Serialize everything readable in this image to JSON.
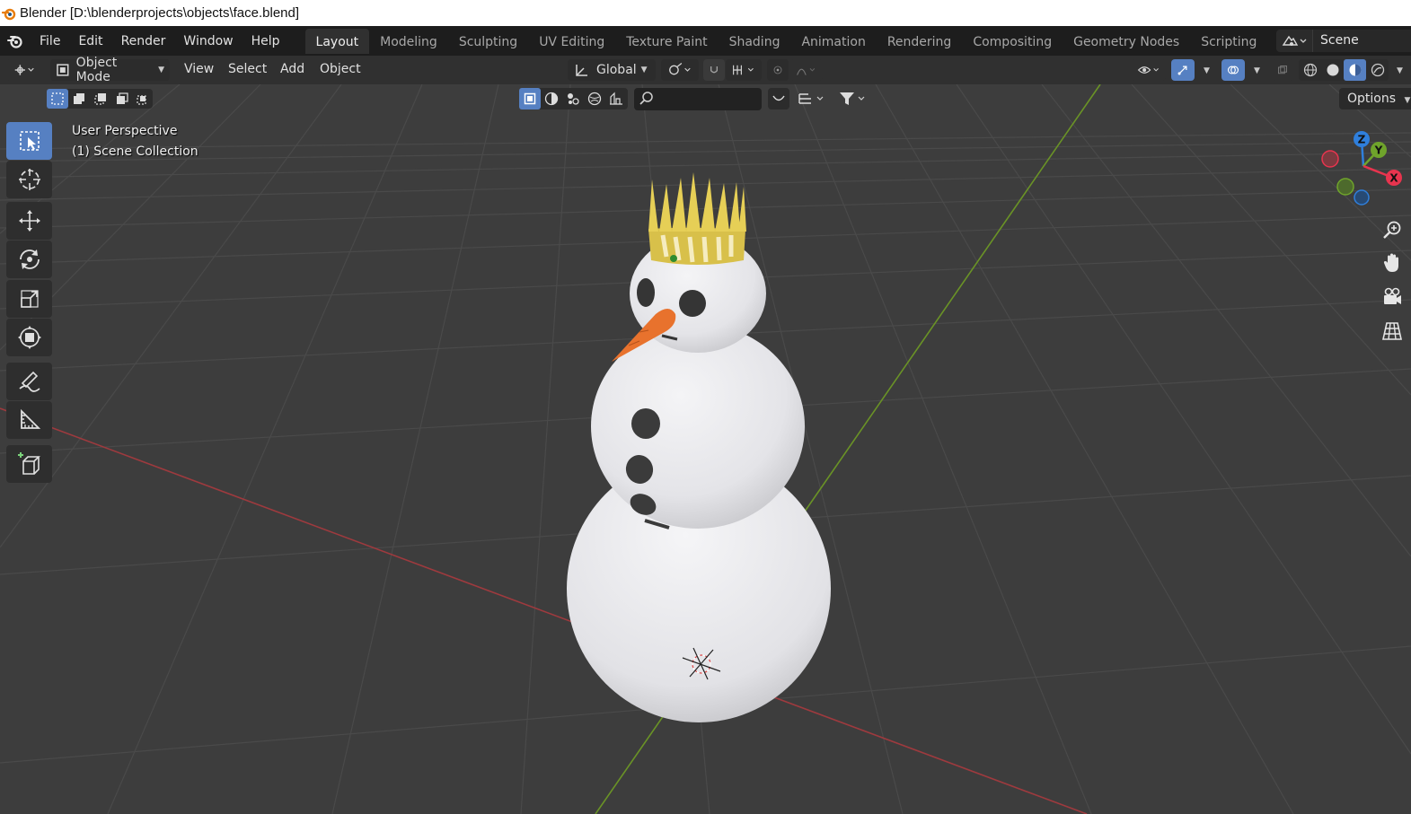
{
  "window": {
    "title": "Blender [D:\\blenderprojects\\objects\\face.blend]"
  },
  "menus": [
    "File",
    "Edit",
    "Render",
    "Window",
    "Help"
  ],
  "workspaces": {
    "tabs": [
      "Layout",
      "Modeling",
      "Sculpting",
      "UV Editing",
      "Texture Paint",
      "Shading",
      "Animation",
      "Rendering",
      "Compositing",
      "Geometry Nodes",
      "Scripting"
    ],
    "active": "Layout",
    "add_symbol": "+"
  },
  "scene": {
    "name": "Scene"
  },
  "viewport_header": {
    "mode": "Object Mode",
    "menus": [
      "View",
      "Select",
      "Add",
      "Object"
    ],
    "transform_orientation": "Global"
  },
  "viewport": {
    "perspective_label": "User Perspective",
    "collection_label": "(1) Scene Collection",
    "options_label": "Options"
  },
  "gizmo": {
    "axes": [
      "Z",
      "Y",
      "X"
    ],
    "colors": {
      "x": "#e8344e",
      "y": "#6fa42b",
      "z": "#2f7fdc"
    }
  },
  "icons": {
    "toolbar": [
      "select-box-icon",
      "cursor-icon",
      "move-icon",
      "rotate-icon",
      "scale-icon",
      "transform-icon",
      "annotate-icon",
      "measure-icon",
      "add-cube-icon"
    ],
    "nav": [
      "zoom-icon",
      "hand-pan-icon",
      "camera-icon",
      "grid-view-icon"
    ]
  },
  "colors": {
    "accent": "#5680c2",
    "viewport_bg": "#3d3d3d",
    "grid_line": "#474747",
    "x_axis": "#b23a3e",
    "y_axis": "#6c9a2a",
    "crown": "#e2c94e",
    "nose": "#e87531"
  }
}
